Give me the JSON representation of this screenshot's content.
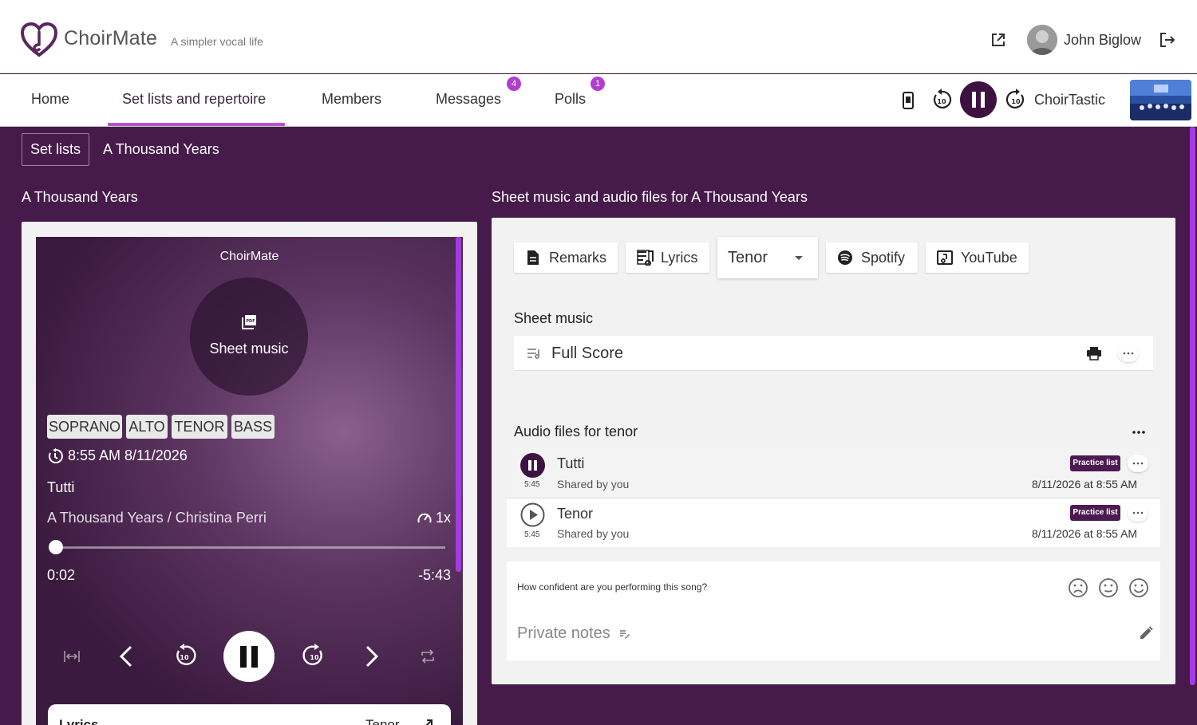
{
  "header": {
    "brand": "ChoirMate",
    "tagline": "A simpler vocal life",
    "user_name": "John Biglow"
  },
  "nav": {
    "tabs": [
      {
        "label": "Home"
      },
      {
        "label": "Set lists and repertoire",
        "active": true
      },
      {
        "label": "Members"
      },
      {
        "label": "Messages",
        "badge": "4"
      },
      {
        "label": "Polls",
        "badge": "1"
      }
    ],
    "mini_player": {
      "choir_name": "ChoirTastic"
    }
  },
  "breadcrumb": {
    "back_label": "Set lists",
    "current": "A Thousand Years"
  },
  "left": {
    "section_title": "A Thousand Years",
    "player": {
      "title": "ChoirMate",
      "disc_label": "Sheet music",
      "voices": [
        "SOPRANO",
        "ALTO",
        "TENOR",
        "BASS"
      ],
      "timestamp": "8:55 AM 8/11/2026",
      "track_name": "Tutti",
      "song_line": "A Thousand Years / Christina Perri",
      "speed": "1x",
      "elapsed": "0:02",
      "remaining": "-5:43",
      "progress": 0.006,
      "lyrics_card_label": "Lyrics",
      "lyrics_card_voice": "Tenor"
    }
  },
  "right": {
    "section_title": "Sheet music and audio files for A Thousand Years",
    "toolbar": {
      "remarks": "Remarks",
      "lyrics": "Lyrics",
      "voice_select": "Tenor",
      "spotify": "Spotify",
      "youtube": "YouTube"
    },
    "sheet_music": {
      "title": "Sheet music",
      "items": [
        {
          "name": "Full Score"
        }
      ]
    },
    "audio": {
      "title": "Audio files for tenor",
      "items": [
        {
          "name": "Tutti",
          "duration": "5:45",
          "shared": "Shared by you",
          "date": "8/11/2026 at 8:55 AM",
          "badge": "Practice list",
          "playing": true
        },
        {
          "name": "Tenor",
          "duration": "5:45",
          "shared": "Shared by you",
          "date": "8/11/2026 at 8:55 AM",
          "badge": "Practice list",
          "playing": false
        }
      ]
    },
    "confidence": {
      "question": "How confident are you performing this song?"
    },
    "notes": {
      "placeholder": "Private notes"
    }
  },
  "colors": {
    "page_bg": "#461a4b",
    "accent": "#b455c7",
    "badge": "#b23ed0",
    "dark_button": "#3e1240"
  }
}
